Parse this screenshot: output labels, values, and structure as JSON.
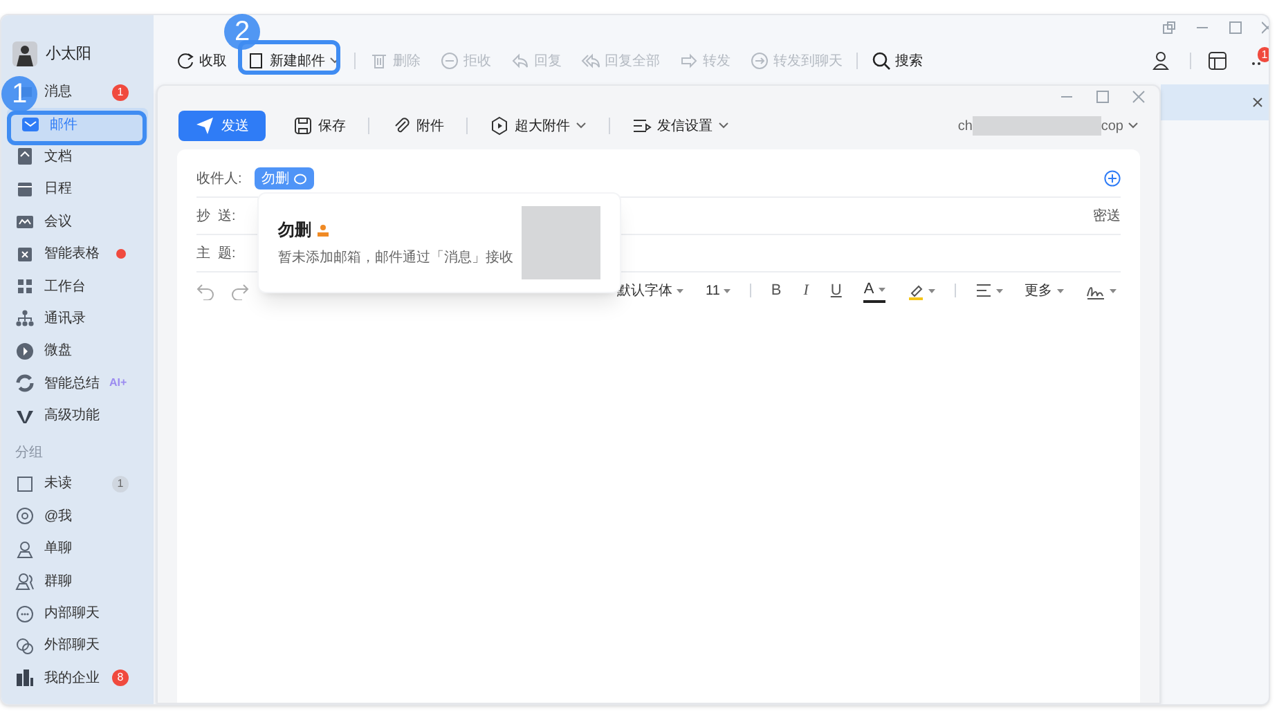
{
  "user": {
    "name": "小太阳"
  },
  "sidebar": {
    "items": [
      {
        "label": "消息",
        "selected": false,
        "badge": {
          "kind": "count",
          "text": "1"
        }
      },
      {
        "label": "邮件",
        "selected": true
      },
      {
        "label": "文档",
        "selected": false
      },
      {
        "label": "日程",
        "selected": false
      },
      {
        "label": "会议",
        "selected": false
      },
      {
        "label": "智能表格",
        "selected": false,
        "badge": {
          "kind": "dot"
        }
      },
      {
        "label": "工作台",
        "selected": false
      },
      {
        "label": "通讯录",
        "selected": false
      },
      {
        "label": "微盘",
        "selected": false
      },
      {
        "label": "智能总结",
        "selected": false,
        "badge": {
          "kind": "ai",
          "text": "AI+"
        }
      },
      {
        "label": "高级功能",
        "selected": false
      }
    ]
  },
  "groups": {
    "title": "分组",
    "items": [
      {
        "label": "未读",
        "selected": false,
        "badge": {
          "kind": "muted",
          "text": "1"
        }
      },
      {
        "label": "@我",
        "selected": false
      },
      {
        "label": "单聊",
        "selected": false
      },
      {
        "label": "群聊",
        "selected": false
      },
      {
        "label": "内部聊天",
        "selected": false
      },
      {
        "label": "外部聊天",
        "selected": false
      },
      {
        "label": "我的企业",
        "selected": false,
        "badge": {
          "kind": "count",
          "text": "8"
        }
      }
    ]
  },
  "toolbar": {
    "items": [
      {
        "label": "收取",
        "disabled": false
      },
      {
        "label": "新建邮件",
        "disabled": false,
        "dropdown": true
      },
      {
        "label": "删除",
        "disabled": true
      },
      {
        "label": "拒收",
        "disabled": true
      },
      {
        "label": "回复",
        "disabled": true
      },
      {
        "label": "回复全部",
        "disabled": true
      },
      {
        "label": "转发",
        "disabled": true
      },
      {
        "label": "转发到聊天",
        "disabled": true
      },
      {
        "label": "搜索",
        "disabled": false
      }
    ],
    "more_badge": "1"
  },
  "compose": {
    "toolbar": [
      {
        "label": "发送",
        "kind": "primary"
      },
      {
        "label": "保存",
        "kind": "plain"
      },
      {
        "label": "附件",
        "kind": "plain"
      },
      {
        "label": "超大附件",
        "kind": "dropdown"
      },
      {
        "label": "发信设置",
        "kind": "dropdown"
      }
    ],
    "account": {
      "prefix": "ch",
      "suffix": "cop"
    },
    "fields": [
      {
        "label": "收件人:",
        "kind": "recipients",
        "chips": [
          "勿删"
        ]
      },
      {
        "label": "抄  送:",
        "kind": "cc",
        "extra": "密送"
      },
      {
        "label": "主  题:",
        "kind": "subject"
      }
    ],
    "format_bar": {
      "font": "默认字体",
      "size": "11",
      "bold": "B",
      "italic": "I",
      "underline": "U",
      "font_color_letter": "A",
      "more": "更多"
    }
  },
  "popup": {
    "name": "勿删",
    "note": "暂未添加邮箱，邮件通过「消息」接收"
  },
  "annotations": [
    {
      "label": "1"
    },
    {
      "label": "2"
    }
  ]
}
